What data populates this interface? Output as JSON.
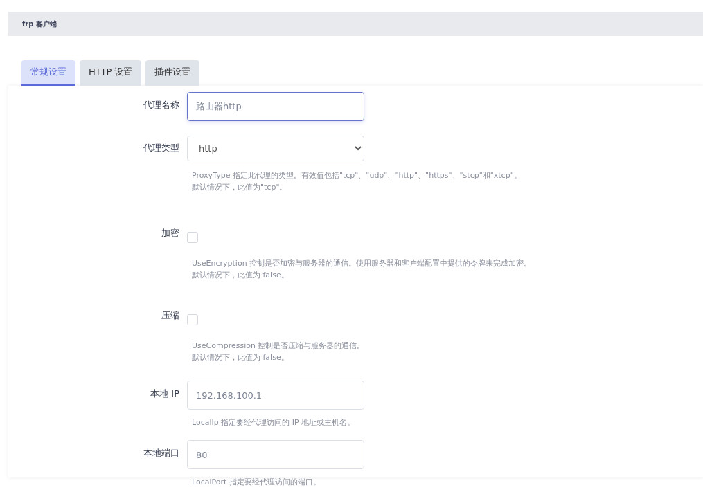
{
  "header": {
    "title": "frp 客户端"
  },
  "tabs": [
    {
      "label": "常规设置",
      "selected": true
    },
    {
      "label": "HTTP 设置",
      "selected": false
    },
    {
      "label": "插件设置",
      "selected": false
    }
  ],
  "fields": [
    {
      "kind": "text",
      "label": "代理名称",
      "value": "路由器http",
      "focused": true
    },
    {
      "kind": "select",
      "label": "代理类型",
      "value": "http",
      "focused": false,
      "help": [
        "ProxyType 指定此代理的类型。有效值包括\"tcp\"、\"udp\"、\"http\"、\"https\"、\"stcp\"和\"xtcp\"。",
        "默认情况下，此值为\"tcp\"。"
      ]
    },
    {
      "kind": "checkbox",
      "label": "加密",
      "checked": false,
      "help": [
        "UseEncryption 控制是否加密与服务器的通信。使用服务器和客户端配置中提供的令牌来完成加密。",
        "默认情况下，此值为 false。"
      ]
    },
    {
      "kind": "checkbox",
      "label": "压缩",
      "checked": false,
      "help": [
        "UseCompression 控制是否压缩与服务器的通信。",
        "默认情况下，此值为 false。"
      ]
    },
    {
      "kind": "text",
      "label": "本地 IP",
      "value": "192.168.100.1",
      "focused": false,
      "help": [
        "LocalIp 指定要经代理访问的 IP 地址或主机名。"
      ]
    },
    {
      "kind": "text",
      "label": "本地端口",
      "value": "80",
      "focused": false,
      "help": [
        "LocalPort 指定要经代理访问的端口。"
      ]
    }
  ]
}
